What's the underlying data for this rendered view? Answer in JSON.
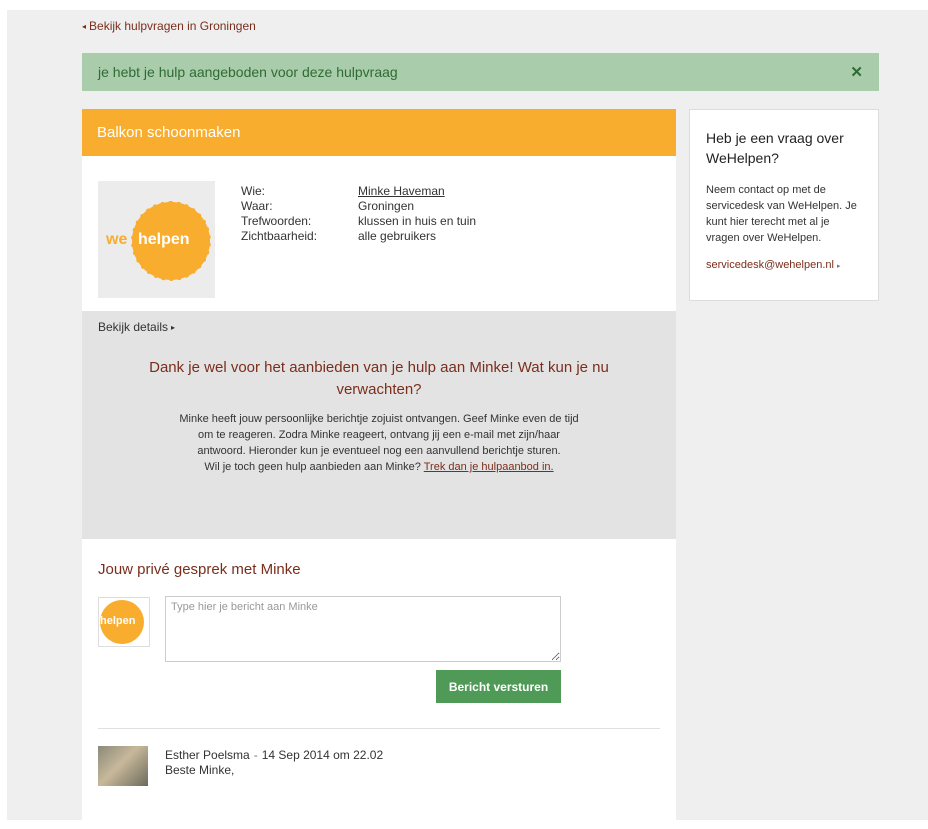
{
  "nav": {
    "back_arrow": "◂",
    "back_label": "Bekijk hulpvragen in Groningen"
  },
  "alert": {
    "text": "je hebt je hulp aangeboden voor deze hulpvraag",
    "close": "✕"
  },
  "request": {
    "title": "Balkon schoonmaken",
    "logo": {
      "we": "we",
      "helpen": "helpen"
    },
    "fields": [
      {
        "key": "Wie:",
        "value": "Minke Haveman"
      },
      {
        "key": "Waar:",
        "value": "Groningen"
      },
      {
        "key": "Trefwoorden:",
        "value": "klussen in huis en tuin"
      },
      {
        "key": "Zichtbaarheid:",
        "value": "alle gebruikers"
      }
    ],
    "details_label": "Bekijk details",
    "details_arrow": "▸"
  },
  "thanks": {
    "heading": "Dank je wel voor het aanbieden van je hulp aan Minke! Wat kun je nu verwachten?",
    "body": "Minke heeft jouw persoonlijke berichtje zojuist ontvangen. Geef Minke even de tijd om te reageren. Zodra Minke reageert, ontvang jij een e-mail met zijn/haar antwoord. Hieronder kun je eventueel nog een aanvullend berichtje sturen.",
    "question": "Wil je toch geen hulp aanbieden aan Minke?",
    "withdraw_link": "Trek dan je hulpaanbod in."
  },
  "chat": {
    "title": "Jouw privé gesprek met Minke",
    "avatar_label": "helpen",
    "placeholder": "Type hier je bericht aan Minke",
    "send_label": "Bericht versturen",
    "messages": [
      {
        "author": "Esther Poelsma",
        "separator": "-",
        "date": "14 Sep 2014 om 22.02",
        "text": "Beste Minke,"
      }
    ]
  },
  "sidebar": {
    "title": "Heb je een vraag over WeHelpen?",
    "text": "Neem contact op met de servicedesk van WeHelpen. Je kunt hier terecht met al je vragen over WeHelpen.",
    "email": "servicedesk@wehelpen.nl",
    "email_arrow": "▸"
  },
  "colors": {
    "brand_orange": "#f9ad2f",
    "accent_red": "#7a2e1c",
    "success_bg": "#a9ccaa",
    "button_green": "#4f9a57"
  }
}
